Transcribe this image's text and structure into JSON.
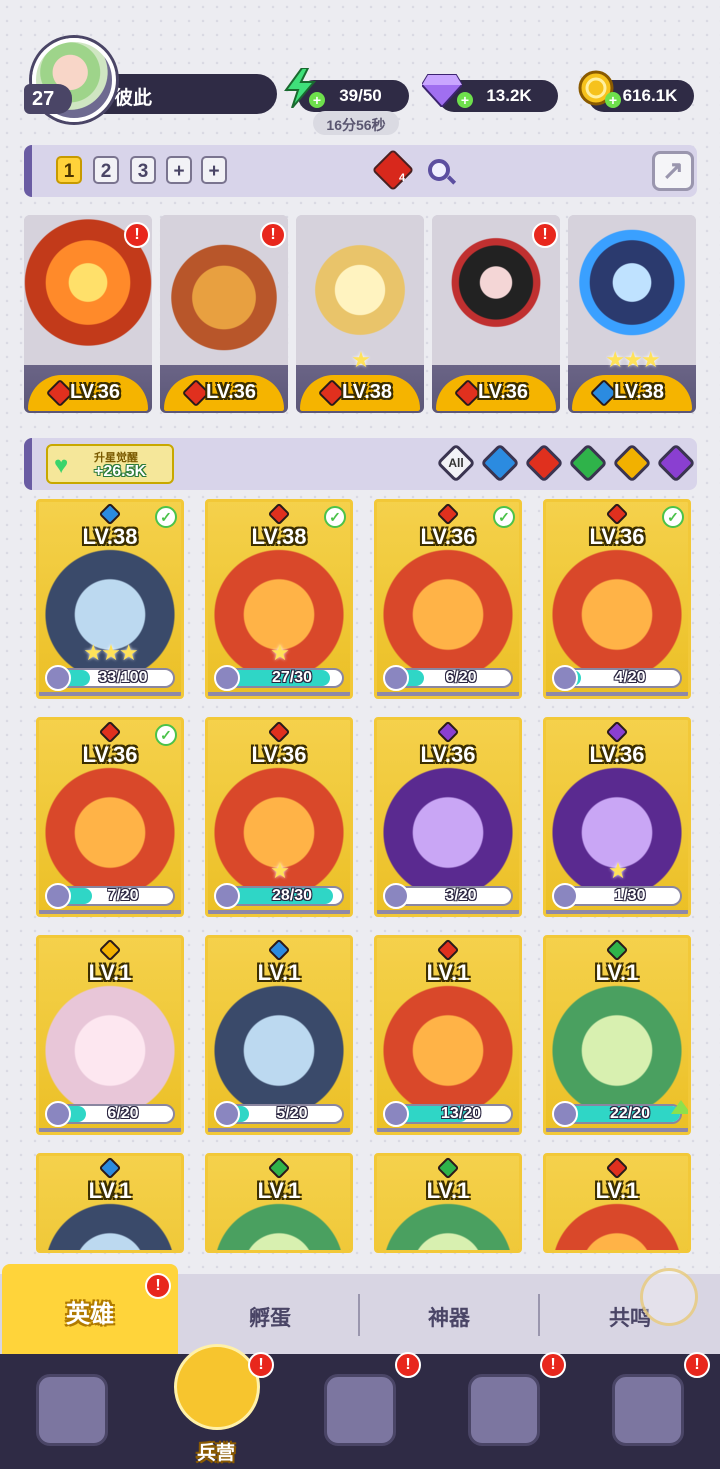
{
  "player": {
    "level": "27",
    "name": "彼此"
  },
  "resources": {
    "energy": "39/50",
    "energy_timer": "16分56秒",
    "gems": "13.2K",
    "coins": "616.1K",
    "plus_symbol": "+"
  },
  "team_bar": {
    "slots": [
      "1",
      "2",
      "3",
      "+",
      "+"
    ],
    "active_slot": "1",
    "fire_gem_count": "4"
  },
  "team": [
    {
      "level": "LV.36",
      "element": "fire",
      "alert": true,
      "stars": ""
    },
    {
      "level": "LV.36",
      "element": "fire",
      "alert": true,
      "stars": ""
    },
    {
      "level": "LV.38",
      "element": "fire",
      "alert": false,
      "stars": "★"
    },
    {
      "level": "LV.36",
      "element": "fire",
      "alert": true,
      "stars": ""
    },
    {
      "level": "LV.38",
      "element": "water",
      "alert": false,
      "stars": "★★★"
    }
  ],
  "filter_bar": {
    "awaken_label": "升星觉醒",
    "awaken_value": "+26.5K",
    "filters": [
      "All",
      "water",
      "fire",
      "wind",
      "light",
      "dark"
    ],
    "all_label": "All"
  },
  "heroes": [
    {
      "level": "LV.38",
      "element": "water",
      "checked": true,
      "shards": "33/100",
      "progress": 0.33,
      "stars": "★★★"
    },
    {
      "level": "LV.38",
      "element": "fire",
      "checked": true,
      "shards": "27/30",
      "progress": 0.9,
      "stars": "★"
    },
    {
      "level": "LV.36",
      "element": "fire",
      "checked": true,
      "shards": "6/20",
      "progress": 0.3,
      "stars": ""
    },
    {
      "level": "LV.36",
      "element": "fire",
      "checked": true,
      "shards": "4/20",
      "progress": 0.2,
      "stars": ""
    },
    {
      "level": "LV.36",
      "element": "fire",
      "checked": true,
      "shards": "7/20",
      "progress": 0.35,
      "stars": ""
    },
    {
      "level": "LV.36",
      "element": "fire",
      "checked": false,
      "shards": "28/30",
      "progress": 0.93,
      "stars": "★"
    },
    {
      "level": "LV.36",
      "element": "dark",
      "checked": false,
      "shards": "3/20",
      "progress": 0.15,
      "stars": ""
    },
    {
      "level": "LV.36",
      "element": "dark",
      "checked": false,
      "shards": "1/30",
      "progress": 0.03,
      "stars": "★"
    },
    {
      "level": "LV.1",
      "element": "light",
      "checked": false,
      "shards": "6/20",
      "progress": 0.3,
      "stars": ""
    },
    {
      "level": "LV.1",
      "element": "water",
      "checked": false,
      "shards": "5/20",
      "progress": 0.25,
      "stars": ""
    },
    {
      "level": "LV.1",
      "element": "fire",
      "checked": false,
      "shards": "13/20",
      "progress": 0.65,
      "stars": ""
    },
    {
      "level": "LV.1",
      "element": "wind",
      "checked": false,
      "shards": "22/20",
      "progress": 1.0,
      "stars": "",
      "upgradable": true
    },
    {
      "level": "LV.1",
      "element": "water",
      "checked": false,
      "shards": "",
      "progress": 0,
      "stars": ""
    },
    {
      "level": "LV.1",
      "element": "wind",
      "checked": false,
      "shards": "",
      "progress": 0,
      "stars": ""
    },
    {
      "level": "LV.1",
      "element": "wind",
      "checked": false,
      "shards": "",
      "progress": 0,
      "stars": ""
    },
    {
      "level": "LV.1",
      "element": "fire",
      "checked": false,
      "shards": "",
      "progress": 0,
      "stars": ""
    }
  ],
  "sub_tabs": {
    "heroes": "英雄",
    "eggs": "孵蛋",
    "artifacts": "神器",
    "resonance": "共鸣"
  },
  "nav": {
    "barracks": "兵营"
  },
  "alert_symbol": "!",
  "check_symbol": "✓"
}
